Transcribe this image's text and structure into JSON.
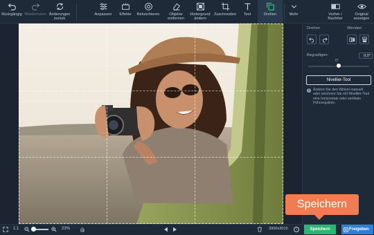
{
  "toolbar": {
    "undo": "Rückgängig",
    "redo": "Wiederholen",
    "changes_back": "Änderungen zurück",
    "adjust": "Anpassen",
    "effects": "Effekte",
    "retouch": "Retuschieren",
    "remove_objects": "Objekte entfernen",
    "change_background": "Hintergrund ändern",
    "crop": "Zuschneiden",
    "text": "Text",
    "rotate": "Drehen",
    "more": "Mehr",
    "before_after": "Vorher / Nachher",
    "show_original": "Original anzeigen",
    "active_tab": "Drehen"
  },
  "panel": {
    "rotate_label": "Drehen",
    "flip_label": "Wenden",
    "straighten_label": "Begradigen:",
    "angle_value": "0,0°",
    "slider_zero": "0°",
    "slider_value": 0,
    "leveling_tool": "Nivellier-Tool",
    "info_text": "Ändern Sie den Winkel manuell oder zeichnen Sie mit Nivellier-Tool eine horizontale oder vertikale Führungslinie."
  },
  "bottom": {
    "fit_label": "1:1",
    "zoom_percent": "23%",
    "dimensions": "3900x3015",
    "save": "Speichern",
    "share": "Freigeben"
  },
  "tooltip": {
    "text": "Speichern"
  },
  "colors": {
    "accent_save": "#2bb673",
    "accent_share": "#2f7fd6",
    "tooltip": "#f07c53",
    "background": "#1b2430",
    "toolbar": "#1f2a38"
  }
}
